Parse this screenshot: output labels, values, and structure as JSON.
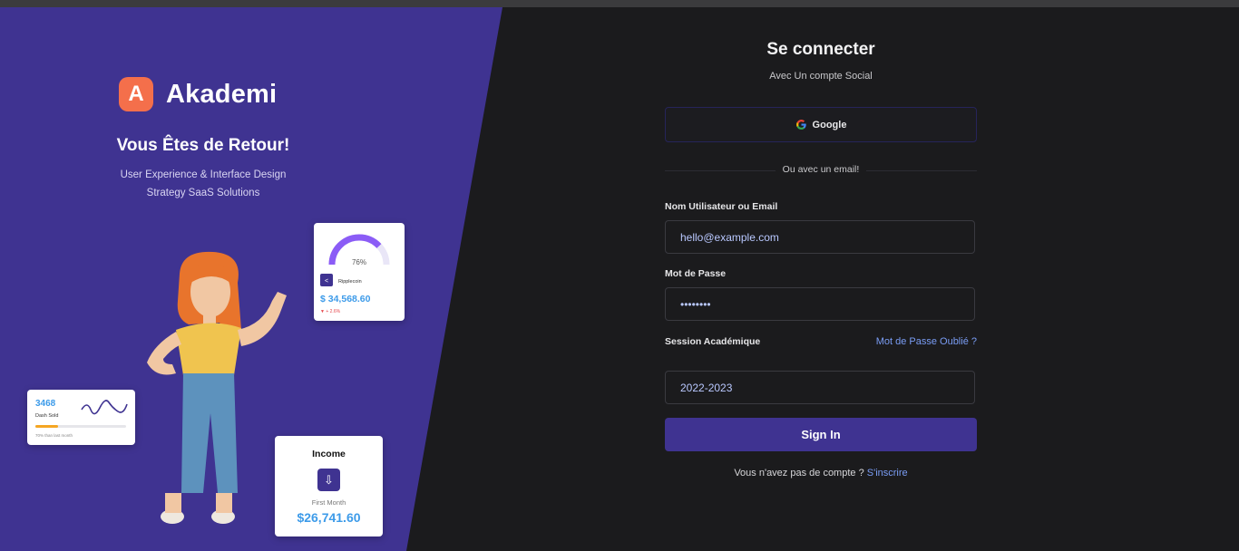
{
  "brand": {
    "logo_letter": "A",
    "name": "Akademi"
  },
  "left": {
    "welcome": "Vous Êtes de Retour!",
    "tagline_line1": "User Experience & Interface Design",
    "tagline_line2": "Strategy SaaS Solutions"
  },
  "cards": {
    "gauge": {
      "percent_label": "76%",
      "percent": 76,
      "coin_name": "Ripplecoin",
      "amount": "$ 34,568.60",
      "change": "▼ + 2.6%"
    },
    "sold": {
      "value": "3468",
      "label": "Dash Sold",
      "progress_fraction": 0.25,
      "note": "70% than last month"
    },
    "income": {
      "title": "Income",
      "label": "First Month",
      "amount": "$26,741.60"
    }
  },
  "form": {
    "title": "Se connecter",
    "subtitle": "Avec Un compte Social",
    "google_label": "Google",
    "divider_text": "Ou avec un email!",
    "username_label": "Nom Utilisateur ou Email",
    "username_value": "hello@example.com",
    "password_label": "Mot de Passe",
    "password_value": "••••••••",
    "session_label": "Session Académique",
    "forgot_link": "Mot de Passe Oublié ?",
    "session_value": "2022-2023",
    "signin_label": "Sign In",
    "no_account_text": "Vous n'avez pas de compte ?",
    "signup_link": "S'inscrire"
  },
  "colors": {
    "accent": "#3f3391",
    "logo": "#f46f4b",
    "link": "#7a9df5",
    "background": "#1b1b1d"
  }
}
